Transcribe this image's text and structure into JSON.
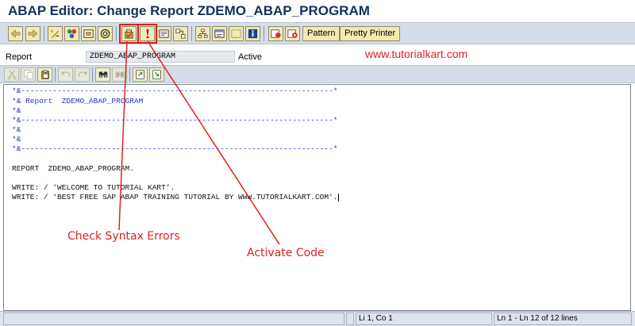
{
  "window": {
    "title": "ABAP Editor: Change Report ZDEMO_ABAP_PROGRAM"
  },
  "toolbar": {
    "pattern_label": "Pattern",
    "pretty_printer_label": "Pretty Printer",
    "highlight_color": "#e0201c",
    "icons": [
      "back-icon",
      "forward-icon",
      "display-change-icon",
      "active-inactive-icon",
      "other-object-icon",
      "where-used-icon",
      "check-syntax-icon",
      "activate-icon",
      "test-icon",
      "display-object-list-icon",
      "hierarchy-icon",
      "navigation-window-icon",
      "help-icon",
      "info-icon",
      "set-breakpoint-icon",
      "set-session-breakpoint-icon"
    ]
  },
  "report": {
    "label": "Report",
    "name": "ZDEMO_ABAP_PROGRAM",
    "status": "Active"
  },
  "watermark": "www.tutorialkart.com",
  "editor": {
    "lines": [
      "*&---------------------------------------------------------------------*",
      "*& Report  ZDEMO_ABAP_PROGRAM",
      "*&",
      "*&---------------------------------------------------------------------*",
      "*&",
      "*&",
      "*&---------------------------------------------------------------------*",
      "",
      "REPORT  ZDEMO_ABAP_PROGRAM.",
      "",
      "WRITE: / 'WELCOME TO TUTORIAL KART'.",
      "WRITE: / 'BEST FREE SAP ABAP TRAINING TUTORIAL BY WWW.TUTORIALKART.COM'."
    ]
  },
  "annotations": {
    "check_syntax": "Check Syntax Errors",
    "activate": "Activate Code"
  },
  "status_bar": {
    "cursor": "Li 1, Co 1",
    "lines": "Ln 1 - Ln 12 of 12 lines"
  }
}
